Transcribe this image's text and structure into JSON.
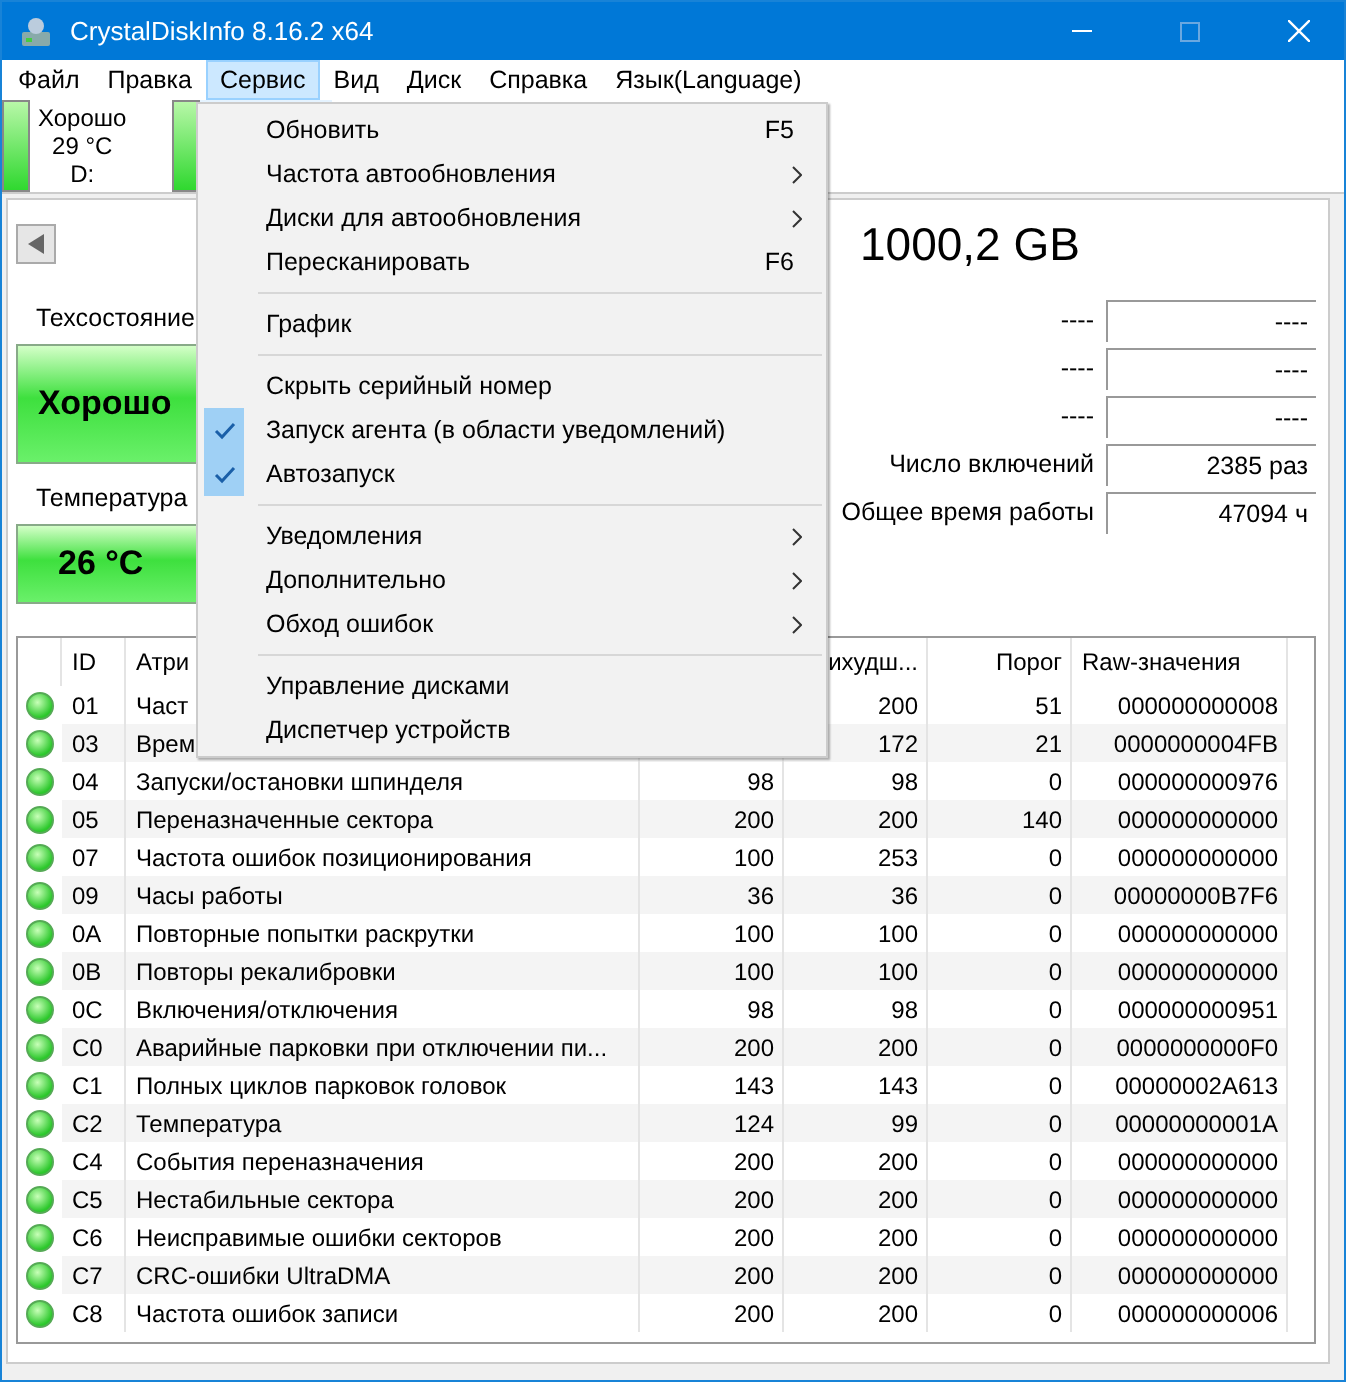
{
  "window": {
    "title": "CrystalDiskInfo 8.16.2 x64"
  },
  "menu_bar": [
    {
      "label": "Файл",
      "selected": false
    },
    {
      "label": "Правка",
      "selected": false
    },
    {
      "label": "Сервис",
      "selected": true
    },
    {
      "label": "Вид",
      "selected": false
    },
    {
      "label": "Диск",
      "selected": false
    },
    {
      "label": "Справка",
      "selected": false
    },
    {
      "label": "Язык(Language)",
      "selected": false
    }
  ],
  "disks": [
    {
      "status": "Хорошо",
      "temperature": "29 °C",
      "letter": "D:",
      "selected": false
    },
    {
      "selected": true
    }
  ],
  "drive_title": "1000,2 GB",
  "health": {
    "label": "Техсостояние",
    "value": "Хорошо"
  },
  "temperature": {
    "label": "Температура",
    "value": "26 °C"
  },
  "info_rows": [
    {
      "left": "----",
      "right": "----"
    },
    {
      "left": "----",
      "right": "----"
    },
    {
      "left": "----",
      "right": "----"
    },
    {
      "left": "Число включений",
      "right": "2385 раз"
    },
    {
      "left": "Общее время работы",
      "right": "47094 ч"
    }
  ],
  "table": {
    "columns": [
      "ID",
      "Атри",
      "ихудш...",
      "Порог",
      "Raw-значения"
    ],
    "rows": [
      {
        "id": "01",
        "attribute": "Част",
        "worst": "200",
        "threshold": "51",
        "raw": "000000000008"
      },
      {
        "id": "03",
        "attribute": "Врем",
        "worst": "172",
        "threshold": "21",
        "raw": "0000000004FB"
      },
      {
        "id": "04",
        "attribute": "Запуски/остановки шпинделя",
        "current": "98",
        "worst": "98",
        "threshold": "0",
        "raw": "000000000976"
      },
      {
        "id": "05",
        "attribute": "Переназначенные сектора",
        "current": "200",
        "worst": "200",
        "threshold": "140",
        "raw": "000000000000"
      },
      {
        "id": "07",
        "attribute": "Частота ошибок позиционирования",
        "current": "100",
        "worst": "253",
        "threshold": "0",
        "raw": "000000000000"
      },
      {
        "id": "09",
        "attribute": "Часы работы",
        "current": "36",
        "worst": "36",
        "threshold": "0",
        "raw": "00000000B7F6"
      },
      {
        "id": "0A",
        "attribute": "Повторные попытки раскрутки",
        "current": "100",
        "worst": "100",
        "threshold": "0",
        "raw": "000000000000"
      },
      {
        "id": "0B",
        "attribute": "Повторы рекалибровки",
        "current": "100",
        "worst": "100",
        "threshold": "0",
        "raw": "000000000000"
      },
      {
        "id": "0C",
        "attribute": "Включения/отключения",
        "current": "98",
        "worst": "98",
        "threshold": "0",
        "raw": "000000000951"
      },
      {
        "id": "C0",
        "attribute": "Аварийные парковки при отключении пи...",
        "current": "200",
        "worst": "200",
        "threshold": "0",
        "raw": "0000000000F0"
      },
      {
        "id": "C1",
        "attribute": "Полных циклов парковок головок",
        "current": "143",
        "worst": "143",
        "threshold": "0",
        "raw": "00000002A613"
      },
      {
        "id": "C2",
        "attribute": "Температура",
        "current": "124",
        "worst": "99",
        "threshold": "0",
        "raw": "00000000001A"
      },
      {
        "id": "C4",
        "attribute": "События переназначения",
        "current": "200",
        "worst": "200",
        "threshold": "0",
        "raw": "000000000000"
      },
      {
        "id": "C5",
        "attribute": "Нестабильные сектора",
        "current": "200",
        "worst": "200",
        "threshold": "0",
        "raw": "000000000000"
      },
      {
        "id": "C6",
        "attribute": "Неисправимые ошибки секторов",
        "current": "200",
        "worst": "200",
        "threshold": "0",
        "raw": "000000000000"
      },
      {
        "id": "C7",
        "attribute": "CRC-ошибки UltraDMA",
        "current": "200",
        "worst": "200",
        "threshold": "0",
        "raw": "000000000000"
      },
      {
        "id": "C8",
        "attribute": "Частота ошибок записи",
        "current": "200",
        "worst": "200",
        "threshold": "0",
        "raw": "000000000006"
      }
    ]
  },
  "dropdown_menu": [
    {
      "kind": "item",
      "label": "Обновить",
      "shortcut": "F5",
      "submenu": false,
      "checked": false
    },
    {
      "kind": "item",
      "label": "Частота автообновления",
      "submenu": true,
      "checked": false
    },
    {
      "kind": "item",
      "label": "Диски для автообновления",
      "submenu": true,
      "checked": false
    },
    {
      "kind": "item",
      "label": "Пересканировать",
      "shortcut": "F6",
      "submenu": false,
      "checked": false
    },
    {
      "kind": "separator"
    },
    {
      "kind": "item",
      "label": "График",
      "submenu": false,
      "checked": false
    },
    {
      "kind": "separator"
    },
    {
      "kind": "item",
      "label": "Скрыть серийный номер",
      "submenu": false,
      "checked": false
    },
    {
      "kind": "item",
      "label": "Запуск агента (в области уведомлений)",
      "submenu": false,
      "checked": true
    },
    {
      "kind": "item",
      "label": "Автозапуск",
      "submenu": false,
      "checked": true
    },
    {
      "kind": "separator"
    },
    {
      "kind": "item",
      "label": "Уведомления",
      "submenu": true,
      "checked": false
    },
    {
      "kind": "item",
      "label": "Дополнительно",
      "submenu": true,
      "checked": false
    },
    {
      "kind": "item",
      "label": "Обход ошибок",
      "submenu": true,
      "checked": false
    },
    {
      "kind": "separator"
    },
    {
      "kind": "item",
      "label": "Управление дисками",
      "submenu": false,
      "checked": false
    },
    {
      "kind": "item",
      "label": "Диспетчер устройств",
      "submenu": false,
      "checked": false
    }
  ]
}
